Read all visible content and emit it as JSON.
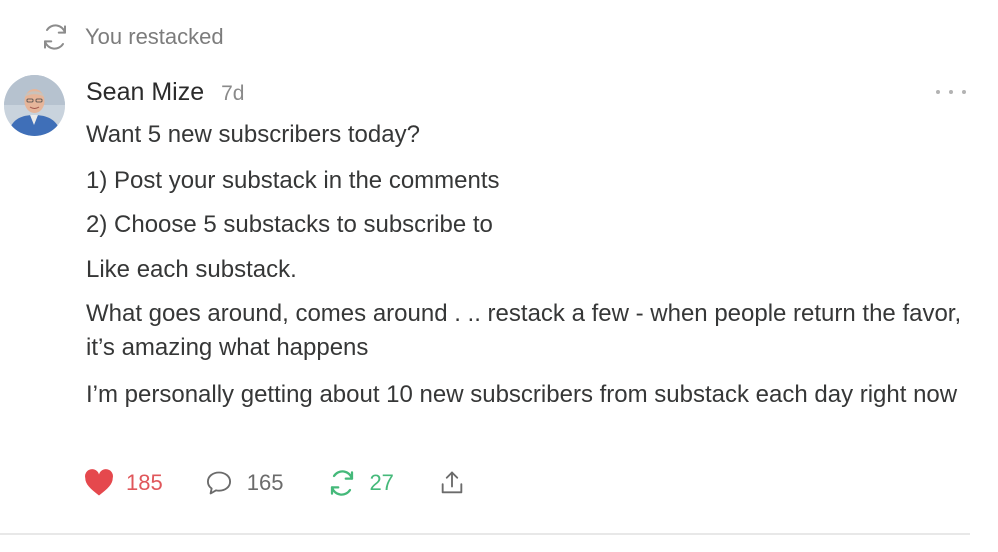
{
  "restack_banner": {
    "label": "You restacked"
  },
  "post": {
    "author": "Sean Mize",
    "time_ago": "7d",
    "paragraphs": [
      "Want 5 new subscribers today?",
      "1) Post your substack in the comments",
      "2) Choose 5 substacks to subscribe to",
      "Like each substack.",
      "What goes around, comes around . .. restack a few - when people return the favor, it’s amazing what happens",
      "I’m personally getting about 10 new subscribers from substack each day right now"
    ]
  },
  "actions": {
    "likes": "185",
    "comments": "165",
    "restacks": "27"
  },
  "icons": {
    "restack_banner": "restack-icon",
    "like": "heart-icon",
    "comment": "comment-bubble-icon",
    "restack": "restack-icon",
    "share": "share-icon",
    "more": "more-options-icon"
  },
  "colors": {
    "like": "#e0575b",
    "restack": "#45b97a",
    "muted": "#7c7c7c",
    "text": "#363737"
  }
}
